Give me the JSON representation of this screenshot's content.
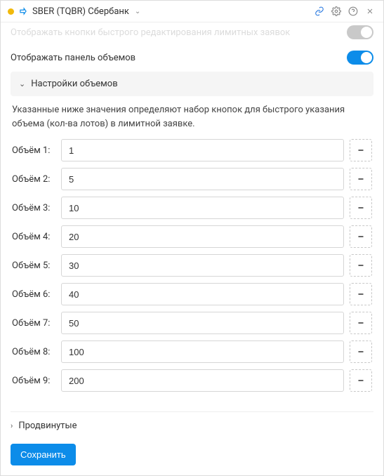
{
  "header": {
    "title": "SBER (TQBR) Сбербанк"
  },
  "toggles": {
    "quick_edit": {
      "label": "Отображать кнопки быстрого редактирования лимитных заявок",
      "on": false
    },
    "volume_panel": {
      "label": "Отображать панель объемов",
      "on": true
    }
  },
  "volumes_section": {
    "title": "Настройки объемов",
    "description": "Указанные ниже значения определяют набор кнопок для быстрого указания объема (кол-ва лотов) в лимитной заявке.",
    "label_prefix": "Объём",
    "items": [
      {
        "value": "1"
      },
      {
        "value": "5"
      },
      {
        "value": "10"
      },
      {
        "value": "20"
      },
      {
        "value": "30"
      },
      {
        "value": "40"
      },
      {
        "value": "50"
      },
      {
        "value": "100"
      },
      {
        "value": "200"
      }
    ]
  },
  "advanced_section": {
    "title": "Продвинутые"
  },
  "footer": {
    "save_label": "Сохранить"
  }
}
